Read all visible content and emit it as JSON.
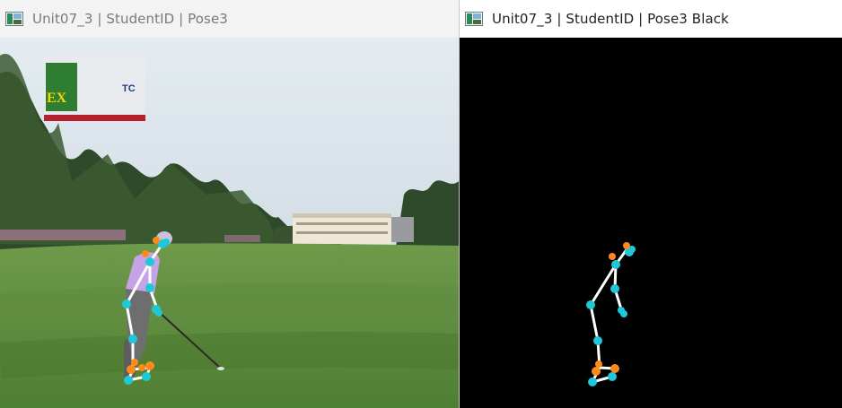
{
  "windows": [
    {
      "title": "Unit07_3 | StudentID | Pose3",
      "icon": "image-viewer-icon",
      "state": "inactive"
    },
    {
      "title": "Unit07_3 | StudentID | Pose3 Black",
      "icon": "image-viewer-icon",
      "state": "active"
    }
  ],
  "scene": {
    "sign_left_text": "EX",
    "sign_right_text": "TC"
  },
  "colors": {
    "keypoint_cyan": "#1ec8d8",
    "keypoint_orange": "#ff8a1c",
    "skeleton_line": "#ffffff",
    "black_background": "#000000"
  }
}
